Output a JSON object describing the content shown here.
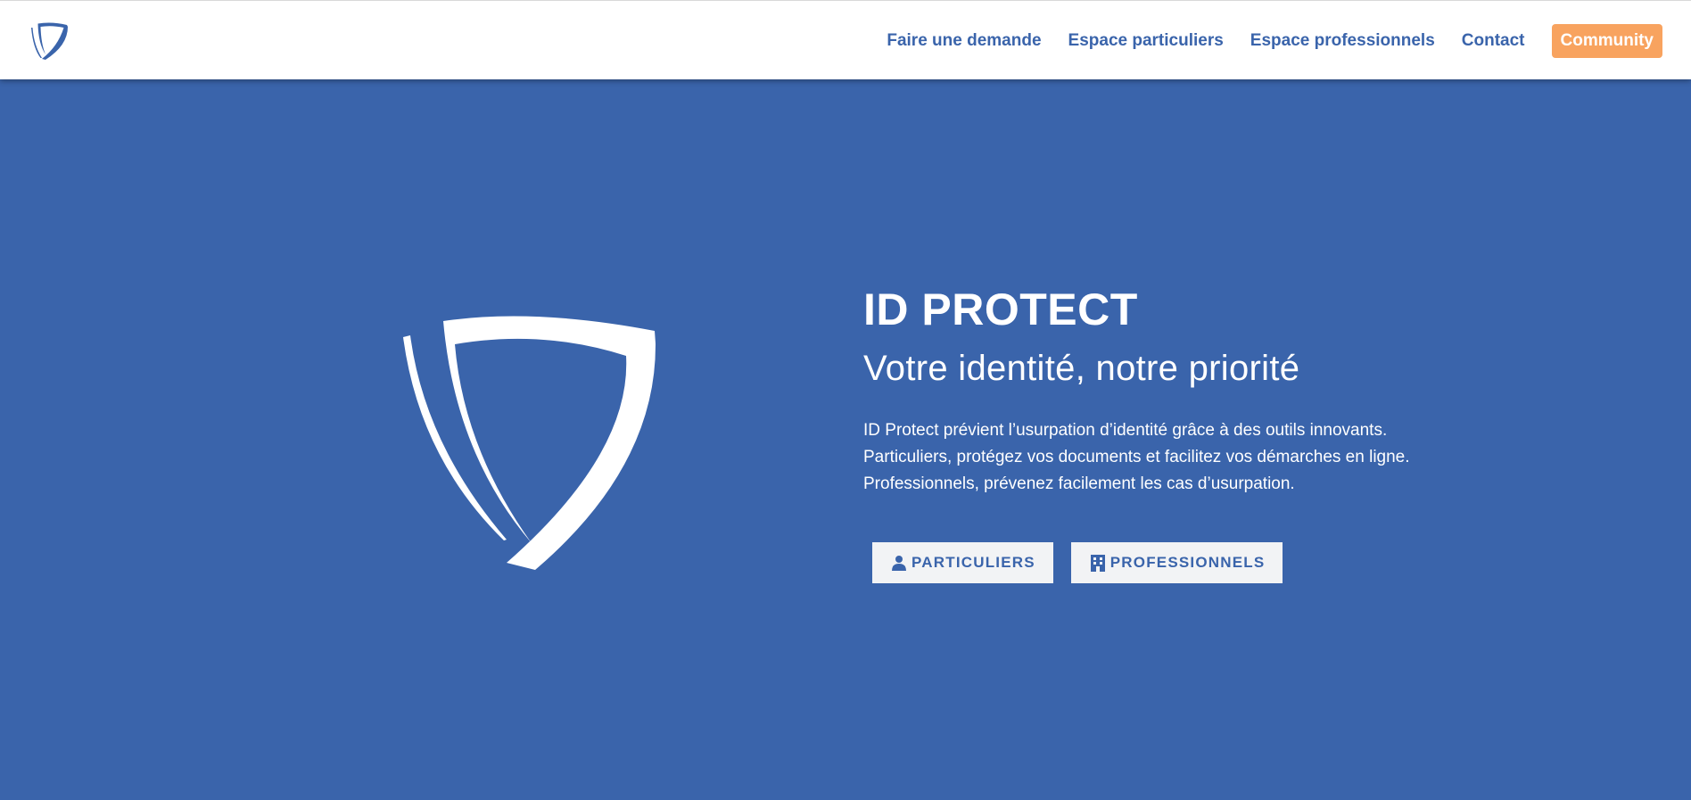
{
  "brand": {
    "logo_icon": "shield-logo-icon",
    "primary_color": "#3a64ab",
    "accent_color": "#f8a35f"
  },
  "nav": {
    "items": [
      {
        "label": "Faire une demande"
      },
      {
        "label": "Espace particuliers"
      },
      {
        "label": "Espace professionnels"
      },
      {
        "label": "Contact"
      }
    ],
    "cta_label": "Community"
  },
  "hero": {
    "title": "ID PROTECT",
    "subtitle": "Votre identité, notre priorité",
    "description": [
      "ID Protect prévient l’usurpation d’identité grâce à des outils innovants.",
      "Particuliers, protégez vos documents et facilitez vos démarches en ligne.",
      "Professionnels, prévenez facilement les cas d’usurpation."
    ],
    "buttons": [
      {
        "label": "PARTICULIERS",
        "icon": "person-icon"
      },
      {
        "label": "PROFESSIONNELS",
        "icon": "building-icon"
      }
    ]
  }
}
